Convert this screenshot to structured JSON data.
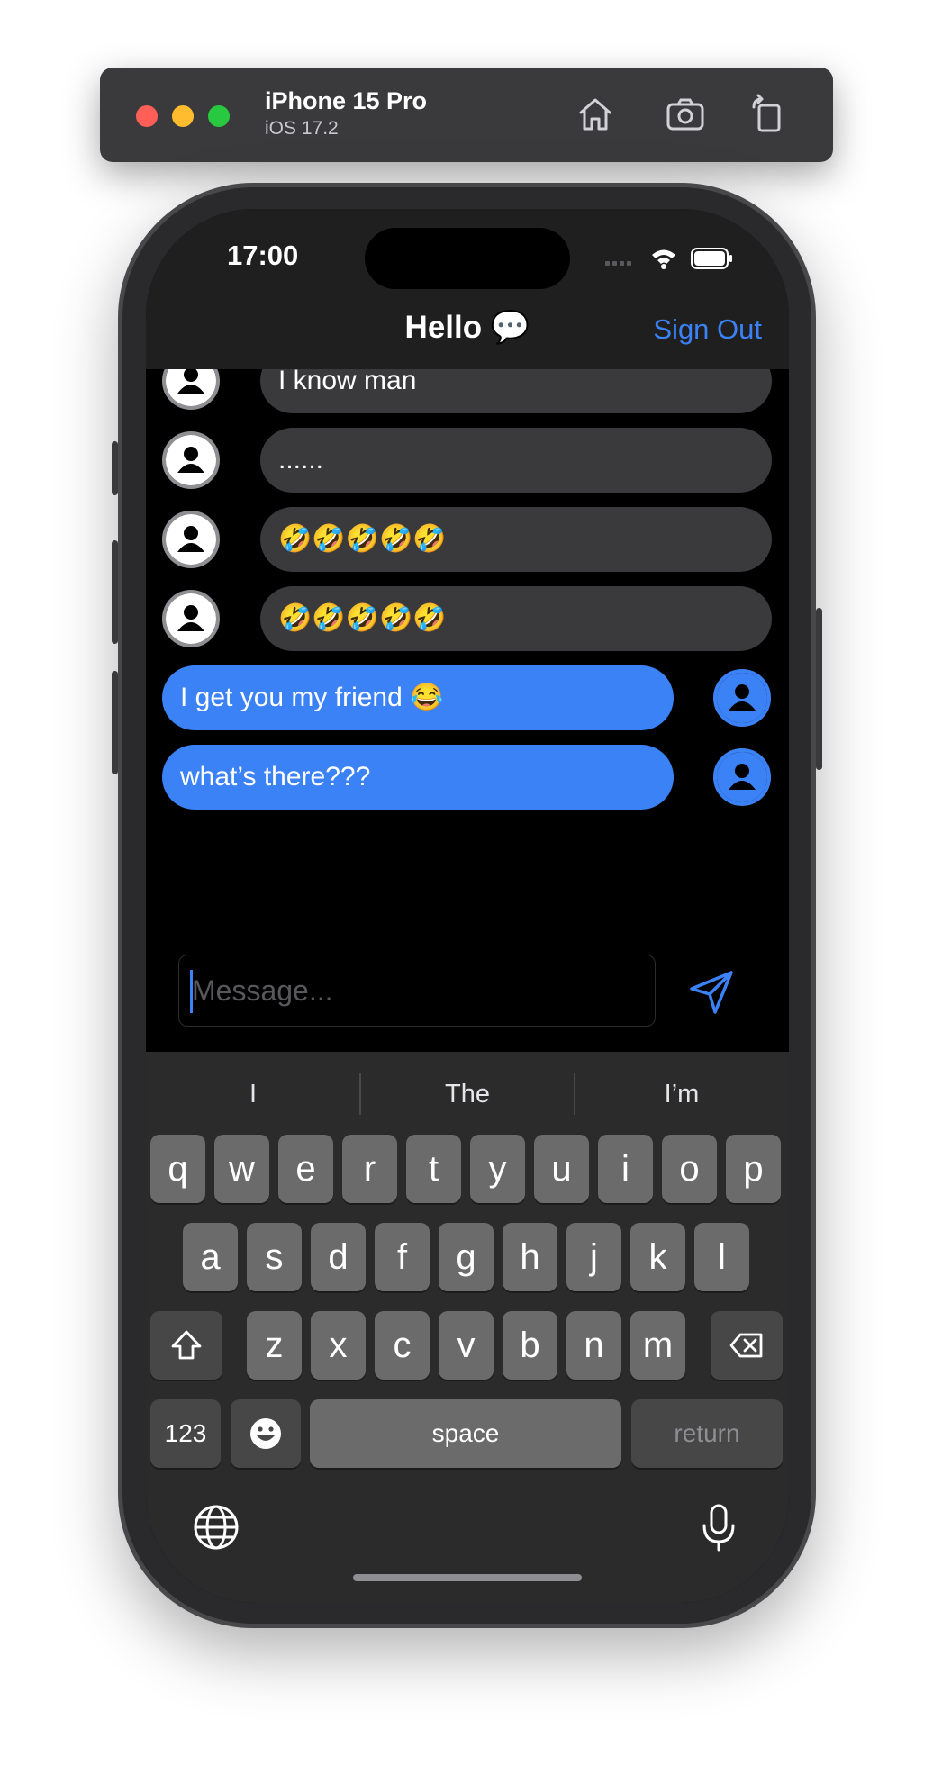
{
  "simulator": {
    "device_name": "iPhone 15 Pro",
    "os_version": "iOS 17.2",
    "icons": [
      "home-icon",
      "screenshot-icon",
      "rotate-icon"
    ]
  },
  "status_bar": {
    "time": "17:00",
    "icons": [
      "signal-icon",
      "wifi-icon",
      "battery-icon"
    ]
  },
  "nav": {
    "title": "Hello",
    "title_emoji": "💬",
    "sign_out": "Sign Out",
    "accent_color": "#3b82f6"
  },
  "messages": [
    {
      "sender": "other",
      "text": "I know man"
    },
    {
      "sender": "other",
      "text": "......"
    },
    {
      "sender": "other",
      "text": "🤣🤣🤣🤣🤣"
    },
    {
      "sender": "other",
      "text": "🤣🤣🤣🤣🤣"
    },
    {
      "sender": "me",
      "text": "I get you my friend 😂"
    },
    {
      "sender": "me",
      "text": "what’s there???"
    }
  ],
  "composer": {
    "placeholder": "Message...",
    "send_icon": "paper-plane-icon"
  },
  "keyboard": {
    "suggestions": [
      "I",
      "The",
      "I’m"
    ],
    "row1": [
      "q",
      "w",
      "e",
      "r",
      "t",
      "y",
      "u",
      "i",
      "o",
      "p"
    ],
    "row2": [
      "a",
      "s",
      "d",
      "f",
      "g",
      "h",
      "j",
      "k",
      "l"
    ],
    "row3": [
      "z",
      "x",
      "c",
      "v",
      "b",
      "n",
      "m"
    ],
    "numbers_key": "123",
    "space_key": "space",
    "return_key": "return",
    "icons": [
      "shift-icon",
      "delete-icon",
      "emoji-icon",
      "globe-icon",
      "microphone-icon"
    ]
  }
}
